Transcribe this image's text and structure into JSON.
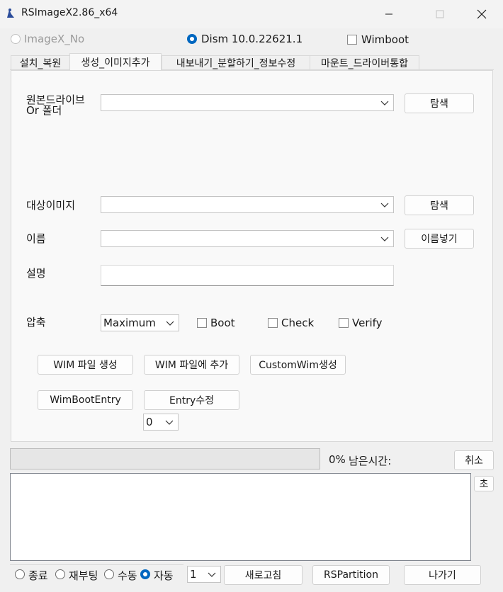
{
  "window": {
    "title": "RSImageX2.86_x64"
  },
  "mode": {
    "imagex_label": "ImageX_No",
    "dism_label": "Dism 10.0.22621.1",
    "wimboot_label": "Wimboot",
    "selected": "dism",
    "imagex_enabled": false,
    "wimboot_checked": false
  },
  "tabs": [
    {
      "label": "설치_복원",
      "active": false
    },
    {
      "label": "생성_이미지추가",
      "active": true
    },
    {
      "label": "내보내기_분할하기_정보수정",
      "active": false
    },
    {
      "label": "마운트_드라이버통합",
      "active": false
    }
  ],
  "form": {
    "source_label_line1": "원본드라이브",
    "source_label_line2": "Or 폴더",
    "source_value": "",
    "source_browse": "탐색",
    "target_label": "대상이미지",
    "target_value": "",
    "target_browse": "탐색",
    "name_label": "이름",
    "name_value": "",
    "name_insert": "이름넣기",
    "desc_label": "설명",
    "desc_value": "",
    "compress_label": "압축",
    "compress_value": "Maximum",
    "boot_label": "Boot",
    "check_label": "Check",
    "verify_label": "Verify"
  },
  "actions": {
    "create_wim": "WIM 파일 생성",
    "append_wim": "WIM 파일에 추가",
    "custom_wim": "CustomWim생성",
    "wimboot_entry": "WimBootEntry",
    "entry_edit": "Entry수정",
    "entry_index": "0"
  },
  "status": {
    "progress_percent": 0,
    "percent_text": "0%",
    "remaining_label": "남은시간:",
    "cancel": "취소",
    "seconds": "초"
  },
  "footer": {
    "options": [
      "종료",
      "재부팅",
      "수동",
      "자동"
    ],
    "selected_option": "자동",
    "count_value": "1",
    "refresh": "새로고침",
    "rspartition": "RSPartition",
    "exit": "나가기"
  },
  "colors": {
    "accent": "#0067c0",
    "progress_fill": "#06b025"
  }
}
